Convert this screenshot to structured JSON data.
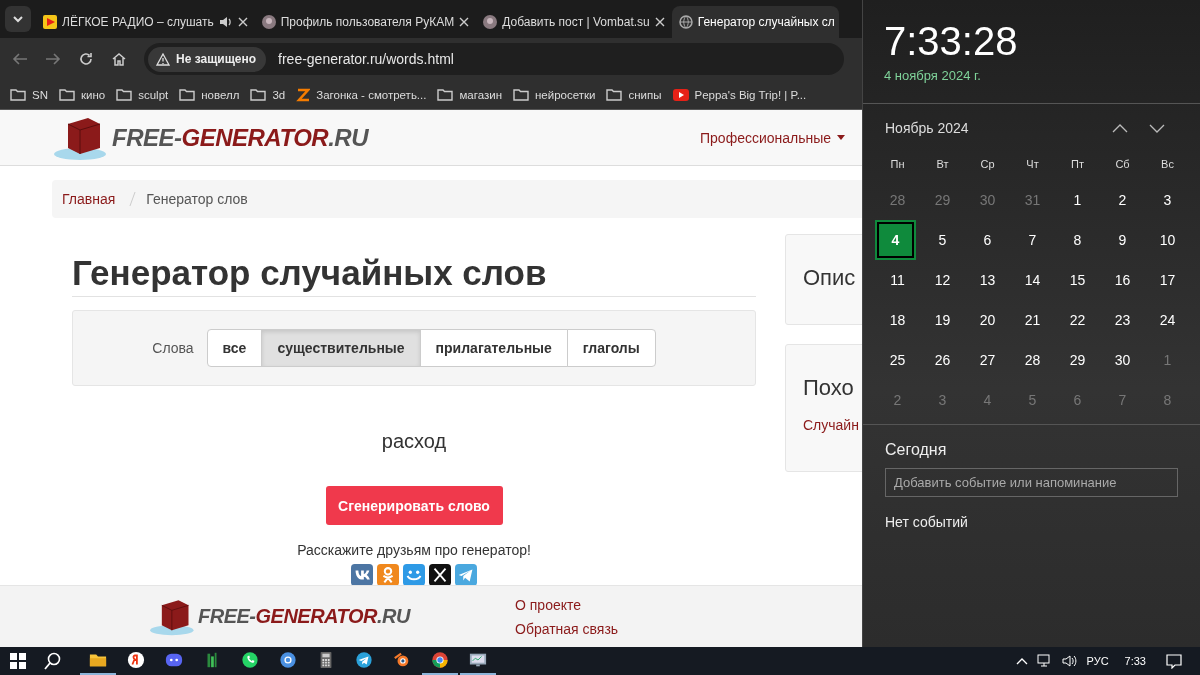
{
  "browser": {
    "tabs": [
      {
        "title": "ЛЁГКОЕ РАДИО – слушать",
        "kind": "play",
        "audio": true,
        "selected": false
      },
      {
        "title": "Профиль пользователя РуКАМ",
        "kind": "avatar",
        "audio": false,
        "selected": false
      },
      {
        "title": "Добавить пост | Vombat.su",
        "kind": "avatar",
        "audio": false,
        "selected": false
      },
      {
        "title": "Генератор случайных сл",
        "kind": "globe",
        "audio": false,
        "selected": true
      }
    ],
    "security": "Не защищено",
    "url": "free-generator.ru/words.html",
    "bookmarks": [
      {
        "label": "SN",
        "kind": "folder"
      },
      {
        "label": "кино",
        "kind": "folder"
      },
      {
        "label": "sculpt",
        "kind": "folder"
      },
      {
        "label": "новелл",
        "kind": "folder"
      },
      {
        "label": "3d",
        "kind": "folder"
      },
      {
        "label": "Загонка - смотреть...",
        "kind": "zlogo"
      },
      {
        "label": "магазин",
        "kind": "folder"
      },
      {
        "label": "нейросетки",
        "kind": "folder"
      },
      {
        "label": "снипы",
        "kind": "folder"
      },
      {
        "label": "Peppa's Big Trip! | P...",
        "kind": "video"
      }
    ]
  },
  "site": {
    "header_logo": [
      {
        "text": "FREE-",
        "color": "#555555"
      },
      {
        "text": "GENERATOR",
        "color": "#8b1a1a"
      },
      {
        "text": ".RU",
        "color": "#555555"
      }
    ],
    "footer_logo": [
      {
        "text": "FREE-",
        "color": "#555555"
      },
      {
        "text": "GENERATOR",
        "color": "#8b1a1a"
      },
      {
        "text": ".RU",
        "color": "#555555"
      }
    ],
    "nav_menu": "Профессиональные",
    "breadcrumb": [
      {
        "label": "Главная",
        "link": true
      },
      {
        "label": "Генератор слов",
        "link": false
      }
    ],
    "heading": "Генератор случайных слов",
    "filter_label": "Слова",
    "filters": [
      {
        "label": "все",
        "selected": false
      },
      {
        "label": "существительные",
        "selected": true
      },
      {
        "label": "прилагательные",
        "selected": false
      },
      {
        "label": "глаголы",
        "selected": false
      }
    ],
    "result": "расход",
    "generate_button": "Сгенерировать слово",
    "share_text": "Расскажите друзьям про генератор!",
    "share_buttons": [
      {
        "kind": "vk",
        "color": "#4c75a3"
      },
      {
        "kind": "ok",
        "color": "#f0881d"
      },
      {
        "kind": "mailru",
        "color": "#2e9ae6"
      },
      {
        "kind": "x",
        "color": "#111111"
      },
      {
        "kind": "telegram",
        "color": "#4aa8df"
      }
    ],
    "sidebar_cards": [
      {
        "title": "Опис"
      },
      {
        "title": "Похо",
        "link": "Случайн"
      }
    ],
    "footer_links": [
      "О проекте",
      "Обратная связь"
    ]
  },
  "flyout": {
    "time": "7:33:28",
    "date": "4 ноября 2024 г.",
    "month": "Ноябрь 2024",
    "weekdays": [
      "Пн",
      "Вт",
      "Ср",
      "Чт",
      "Пт",
      "Сб",
      "Вс"
    ],
    "weeks": [
      [
        {
          "day": "28",
          "dimmed": true,
          "selected": false
        },
        {
          "day": "29",
          "dimmed": true,
          "selected": false
        },
        {
          "day": "30",
          "dimmed": true,
          "selected": false
        },
        {
          "day": "31",
          "dimmed": true,
          "selected": false
        },
        {
          "day": "1",
          "dimmed": false,
          "selected": false
        },
        {
          "day": "2",
          "dimmed": false,
          "selected": false
        },
        {
          "day": "3",
          "dimmed": false,
          "selected": false
        }
      ],
      [
        {
          "day": "4",
          "dimmed": false,
          "selected": true
        },
        {
          "day": "5",
          "dimmed": false,
          "selected": false
        },
        {
          "day": "6",
          "dimmed": false,
          "selected": false
        },
        {
          "day": "7",
          "dimmed": false,
          "selected": false
        },
        {
          "day": "8",
          "dimmed": false,
          "selected": false
        },
        {
          "day": "9",
          "dimmed": false,
          "selected": false
        },
        {
          "day": "10",
          "dimmed": false,
          "selected": false
        }
      ],
      [
        {
          "day": "11",
          "dimmed": false,
          "selected": false
        },
        {
          "day": "12",
          "dimmed": false,
          "selected": false
        },
        {
          "day": "13",
          "dimmed": false,
          "selected": false
        },
        {
          "day": "14",
          "dimmed": false,
          "selected": false
        },
        {
          "day": "15",
          "dimmed": false,
          "selected": false
        },
        {
          "day": "16",
          "dimmed": false,
          "selected": false
        },
        {
          "day": "17",
          "dimmed": false,
          "selected": false
        }
      ],
      [
        {
          "day": "18",
          "dimmed": false,
          "selected": false
        },
        {
          "day": "19",
          "dimmed": false,
          "selected": false
        },
        {
          "day": "20",
          "dimmed": false,
          "selected": false
        },
        {
          "day": "21",
          "dimmed": false,
          "selected": false
        },
        {
          "day": "22",
          "dimmed": false,
          "selected": false
        },
        {
          "day": "23",
          "dimmed": false,
          "selected": false
        },
        {
          "day": "24",
          "dimmed": false,
          "selected": false
        }
      ],
      [
        {
          "day": "25",
          "dimmed": false,
          "selected": false
        },
        {
          "day": "26",
          "dimmed": false,
          "selected": false
        },
        {
          "day": "27",
          "dimmed": false,
          "selected": false
        },
        {
          "day": "28",
          "dimmed": false,
          "selected": false
        },
        {
          "day": "29",
          "dimmed": false,
          "selected": false
        },
        {
          "day": "30",
          "dimmed": false,
          "selected": false
        },
        {
          "day": "1",
          "dimmed": true,
          "selected": false
        }
      ],
      [
        {
          "day": "2",
          "dimmed": true,
          "selected": false
        },
        {
          "day": "3",
          "dimmed": true,
          "selected": false
        },
        {
          "day": "4",
          "dimmed": true,
          "selected": false
        },
        {
          "day": "5",
          "dimmed": true,
          "selected": false
        },
        {
          "day": "6",
          "dimmed": true,
          "selected": false
        },
        {
          "day": "7",
          "dimmed": true,
          "selected": false
        },
        {
          "day": "8",
          "dimmed": true,
          "selected": false
        }
      ]
    ],
    "today_label": "Сегодня",
    "event_placeholder": "Добавить событие или напоминание",
    "no_events": "Нет событий"
  },
  "taskbar": {
    "apps": [
      {
        "kind": "explorer",
        "running": true
      },
      {
        "kind": "yandex",
        "running": false
      },
      {
        "kind": "discord",
        "running": false
      },
      {
        "kind": "bars",
        "running": false
      },
      {
        "kind": "whatsapp",
        "running": false
      },
      {
        "kind": "ring",
        "running": false
      },
      {
        "kind": "calculator",
        "running": false
      },
      {
        "kind": "telegram",
        "running": false
      },
      {
        "kind": "blender",
        "running": false
      },
      {
        "kind": "chrome",
        "running": true
      },
      {
        "kind": "monitor",
        "running": true
      }
    ],
    "language": "РУС",
    "clock": "7:33"
  }
}
